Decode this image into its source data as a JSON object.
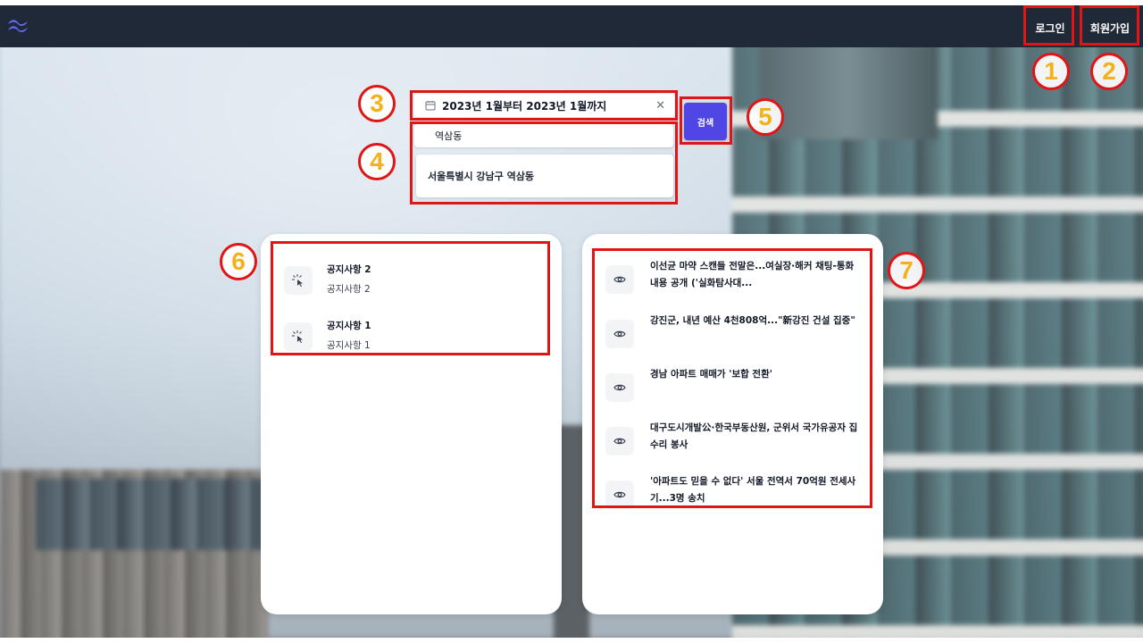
{
  "nav": {
    "login_label": "로그인",
    "signup_label": "회원가입"
  },
  "search": {
    "date_range": "2023년 1월부터 2023년 1월까지",
    "location_value": "역삼동",
    "suggestion": "서울특별시 강남구 역삼동",
    "button_label": "검색"
  },
  "notices": [
    {
      "title": "공지사항 2",
      "subtitle": "공지사항 2"
    },
    {
      "title": "공지사항 1",
      "subtitle": "공지사항 1"
    }
  ],
  "news": [
    {
      "headline": "이선균 마약 스캔들 전말은...여실장·해커 채팅-통화 내용 공개 ('실화탐사대..."
    },
    {
      "headline": "강진군, 내년 예산 4천808억...\"新강진 건설 집중\""
    },
    {
      "headline": "경남 아파트 매매가 '보합 전환'"
    },
    {
      "headline": "대구도시개발公·한국부동산원, 군위서 국가유공자 집수리 봉사"
    },
    {
      "headline": "'아파트도 믿을 수 없다' 서울 전역서 70억원 전세사기...3명 송치"
    }
  ],
  "annotations": [
    "1",
    "2",
    "3",
    "4",
    "5",
    "6",
    "7"
  ],
  "icons": {
    "logo": "tailwind-logo-icon",
    "calendar": "calendar-icon",
    "clear": "close-icon",
    "notice": "cursor-click-icon",
    "news": "eye-icon"
  },
  "colors": {
    "navbar": "#1f2937",
    "accent": "#4f46e5",
    "annotation_border": "#e01515",
    "annotation_number": "#f3b21b"
  }
}
